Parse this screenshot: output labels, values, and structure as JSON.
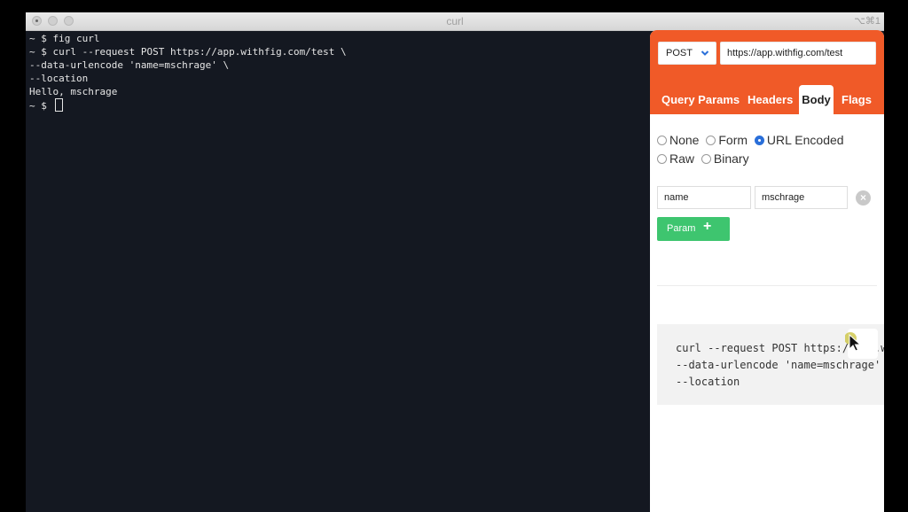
{
  "window": {
    "title": "curl",
    "shortcut": "⌥⌘1"
  },
  "terminal": {
    "lines": [
      "~ $ fig curl",
      "~ $ curl --request POST https://app.withfig.com/test \\",
      "--data-urlencode 'name=mschrage' \\",
      "--location",
      "Hello, mschrage",
      "~ $ "
    ]
  },
  "panel": {
    "method": "POST",
    "url": "https://app.withfig.com/test",
    "tabs": [
      "Query Params",
      "Headers",
      "Body",
      "Flags"
    ],
    "active_tab": "Body",
    "body_types": [
      "None",
      "Form",
      "URL Encoded",
      "Raw",
      "Binary"
    ],
    "selected_body_type": "URL Encoded",
    "params": [
      {
        "key": "name",
        "value": "mschrage"
      }
    ],
    "remove_glyph": "×",
    "add_param_label": "Param",
    "add_glyph": "+",
    "code_preview": [
      "curl --request POST https://app.withfig.com/test \\",
      "--data-urlencode 'name=mschrage' \\",
      "--location"
    ]
  },
  "colors": {
    "accent": "#f05a28",
    "button_green": "#3ec56f",
    "terminal_bg": "#141821"
  },
  "icons": [
    "chevron-down-icon",
    "plus-icon",
    "close-icon",
    "mouse-pointer-icon"
  ]
}
